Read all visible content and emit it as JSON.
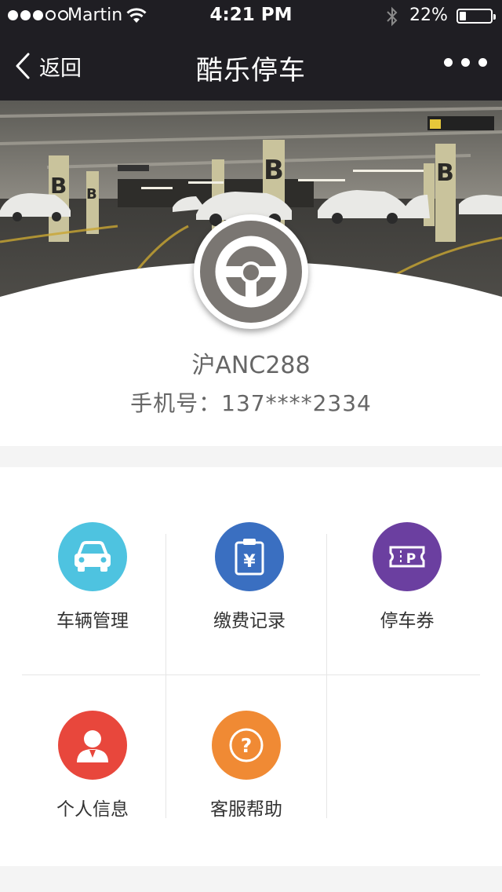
{
  "status_bar": {
    "carrier": "Martin",
    "time": "4:21 PM",
    "battery_percent": "22%",
    "battery_level": 0.22,
    "signal_filled": 3,
    "signal_total": 5
  },
  "nav": {
    "back_label": "返回",
    "title": "酷乐停车"
  },
  "profile": {
    "plate": "沪ANC288",
    "phone": "手机号：137****2334"
  },
  "menu": {
    "items": [
      {
        "label": "车辆管理",
        "icon": "car-icon",
        "color": "#4ec3e0"
      },
      {
        "label": "缴费记录",
        "icon": "payment-clipboard-icon",
        "color": "#3a6fc1"
      },
      {
        "label": "停车券",
        "icon": "parking-ticket-icon",
        "color": "#6b3fa0"
      },
      {
        "label": "个人信息",
        "icon": "person-icon",
        "color": "#e8473c"
      },
      {
        "label": "客服帮助",
        "icon": "question-icon",
        "color": "#f08a34"
      }
    ]
  },
  "colors": {
    "nav_bg": "#1f1e23",
    "page_bg": "#f4f4f4",
    "avatar_bg": "#7a7672"
  }
}
